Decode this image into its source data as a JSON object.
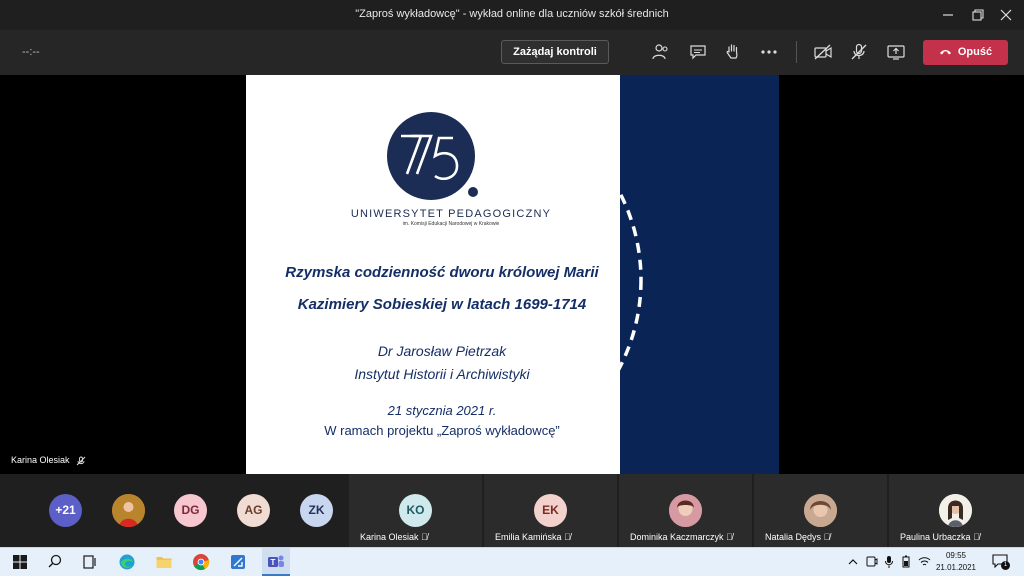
{
  "window": {
    "title": "\"Zaproś wykładowcę\" - wykład online dla uczniów szkół średnich"
  },
  "toolbar": {
    "timer": "--:--",
    "request_control_label": "Zażądaj kontroli",
    "leave_label": "Opuść",
    "icons": [
      "participants-icon",
      "chat-icon",
      "raise-hand-icon",
      "more-actions-icon",
      "camera-off-icon",
      "mic-off-icon",
      "share-screen-icon"
    ]
  },
  "slide": {
    "logo_text": "75.",
    "university": "UNIWERSYTET PEDAGOGICZNY",
    "university_sub": "im. Komisji Edukacji Narodowej w Krakowie",
    "title_line1": "Rzymska codzienność dworu królowej Marii",
    "title_line2": "Kazimiery Sobieskiej w latach 1699-1714",
    "author": "Dr Jarosław Pietrzak",
    "institute": "Instytut Historii i Archiwistyki",
    "date": "21 stycznia 2021 r.",
    "project": "W ramach projektu „Zaproś wykładowcę”",
    "colors": {
      "navy": "#0b2456",
      "text": "#142e66"
    }
  },
  "presenter": {
    "name": "Karina Olesiak"
  },
  "participants": {
    "overflow": "+21",
    "avatars": [
      {
        "initials": "",
        "color": "#c9663a"
      },
      {
        "initials": "DG",
        "color": "#f6c7cf"
      },
      {
        "initials": "AG",
        "color": "#f0dcd2"
      },
      {
        "initials": "ZK",
        "color": "#c9d6ef"
      }
    ],
    "tiles": [
      {
        "initials": "KO",
        "name": "Karina Olesiak",
        "color": "#cfe9ec"
      },
      {
        "initials": "EK",
        "name": "Emilia Kamińska",
        "color": "#f3d1cc"
      },
      {
        "initials": "",
        "name": "Dominika Kaczmarczyk",
        "color": "#b97a7a"
      },
      {
        "initials": "",
        "name": "Natalia Dędys",
        "color": "#a98a73"
      },
      {
        "initials": "",
        "name": "Paulina Urbaczka",
        "color": "#ddd6cc"
      }
    ]
  },
  "taskbar": {
    "time": "09:55",
    "date": "21.01.2021",
    "notifications": "1"
  }
}
